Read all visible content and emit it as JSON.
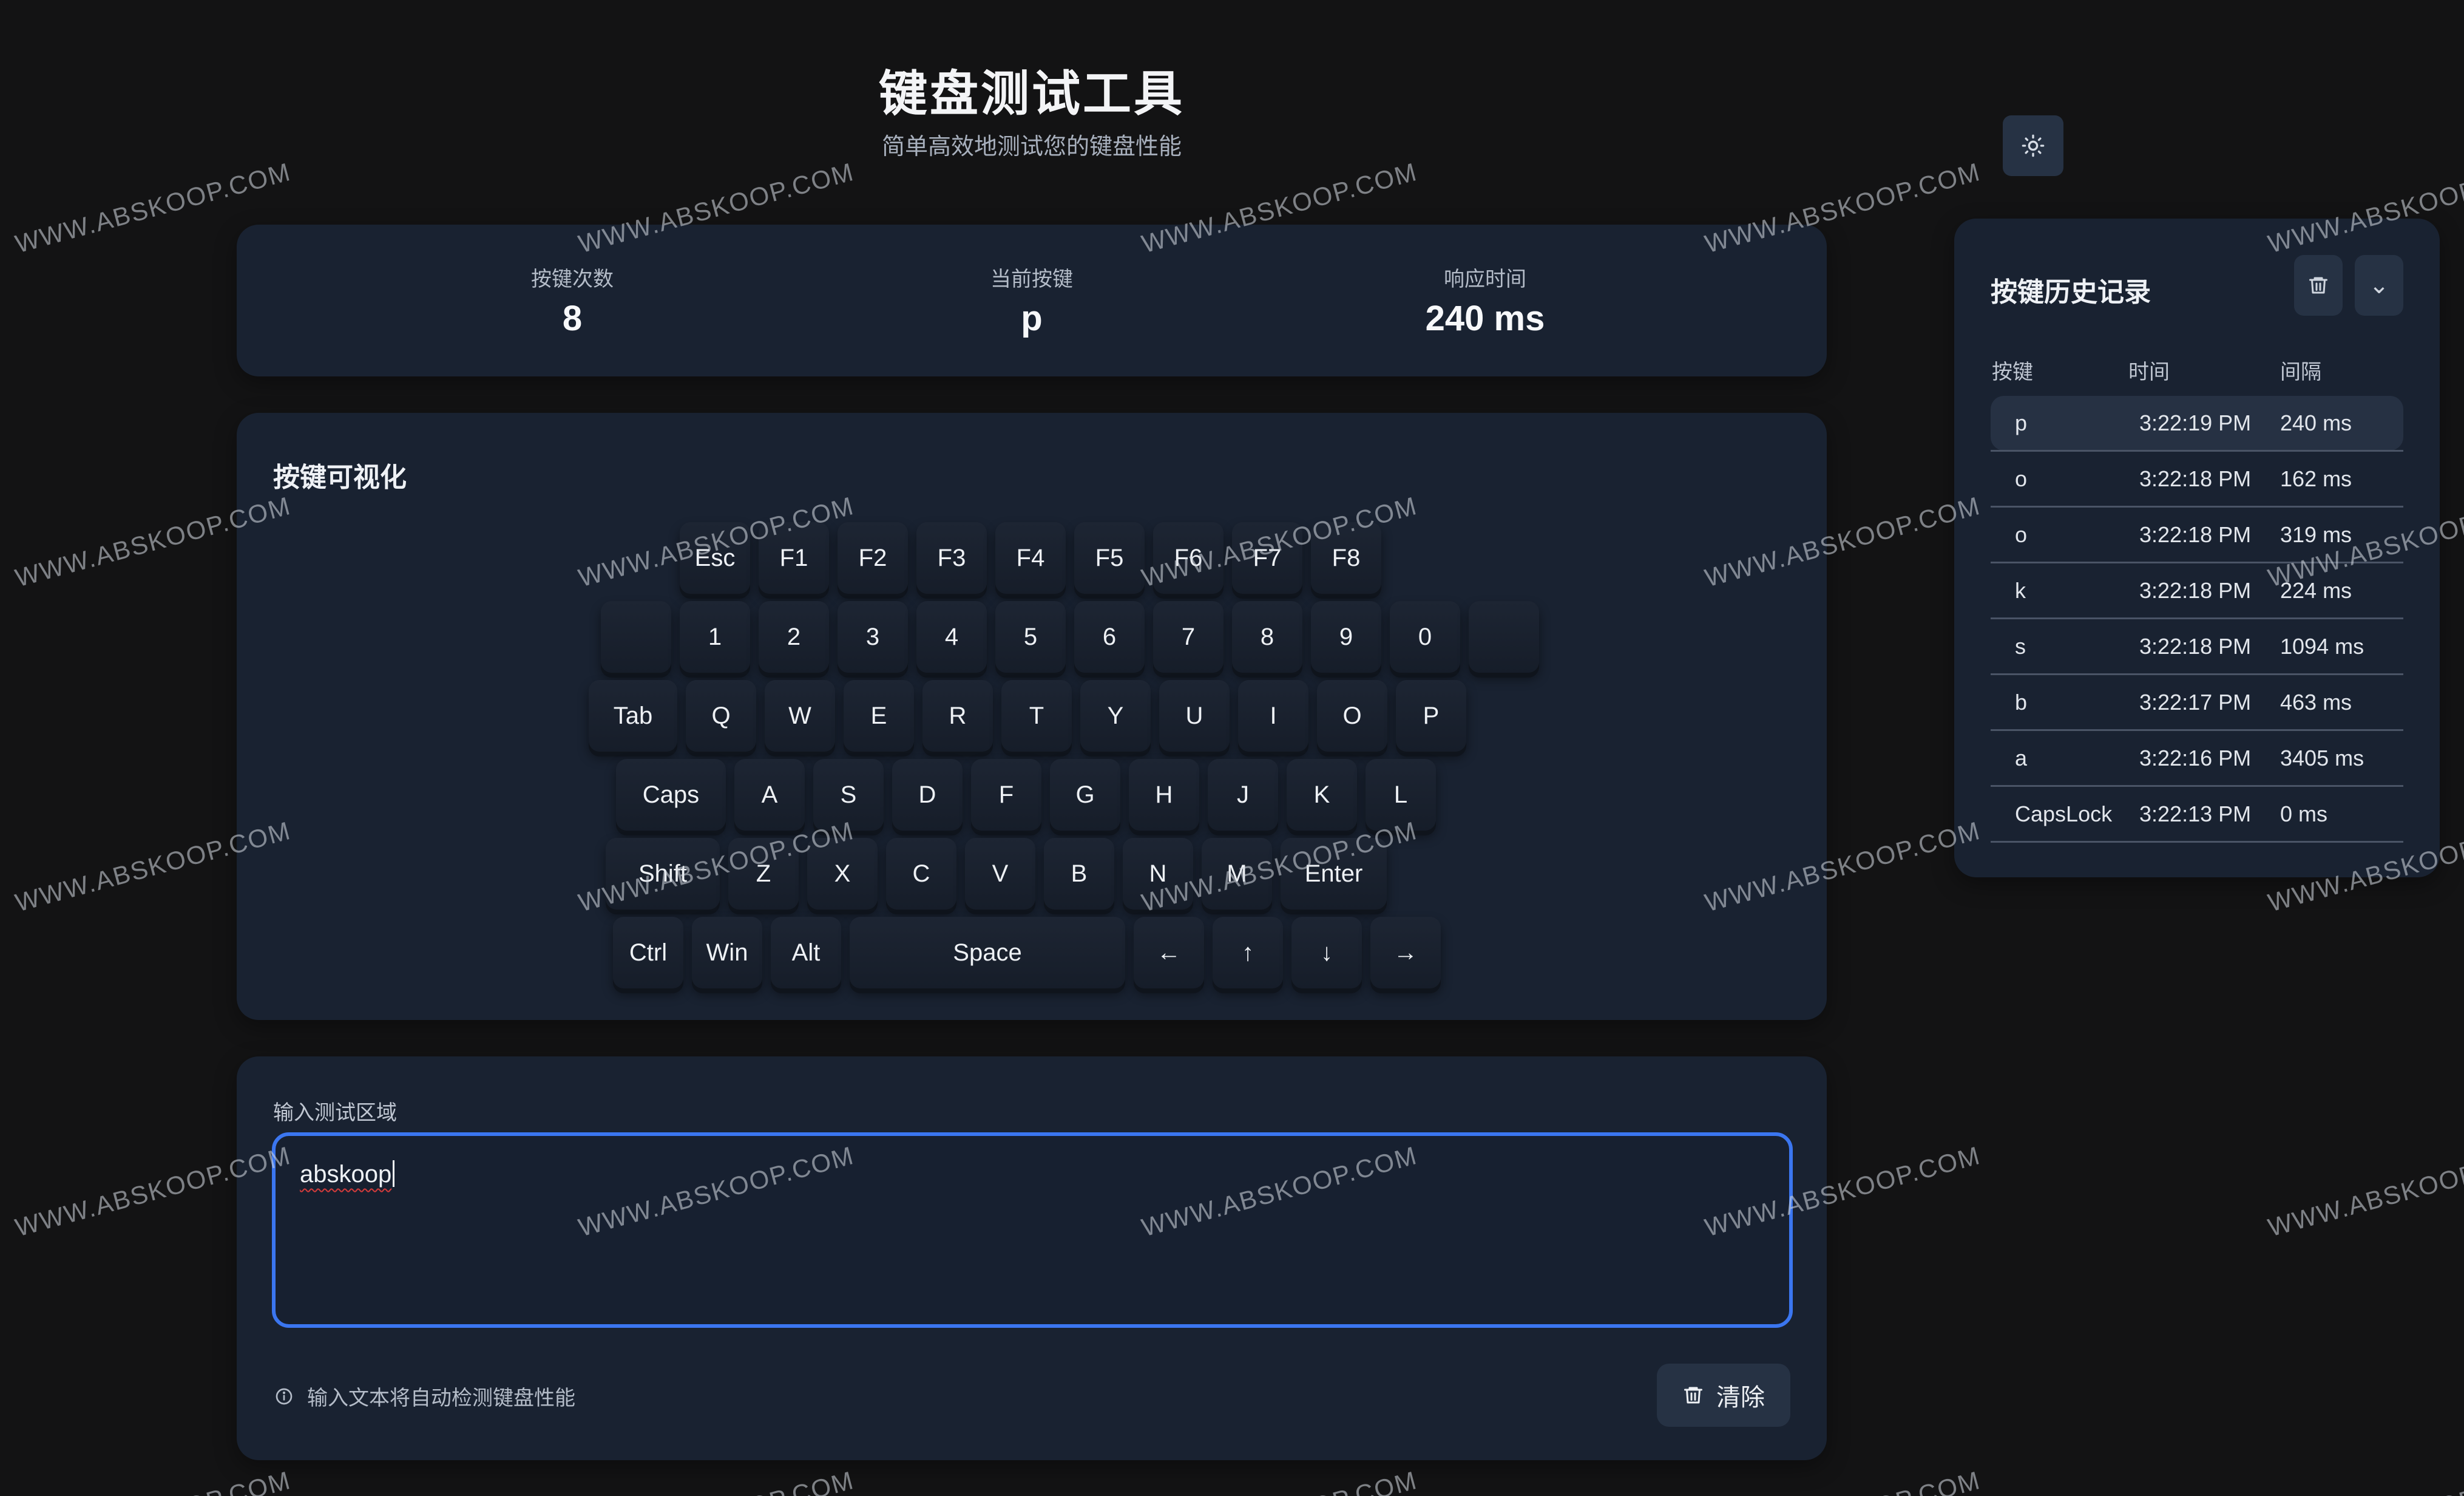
{
  "header": {
    "title": "键盘测试工具",
    "subtitle": "简单高效地测试您的键盘性能"
  },
  "stats": {
    "count_label": "按键次数",
    "count_value": "8",
    "current_label": "当前按键",
    "current_value": "p",
    "response_label": "响应时间",
    "response_value": "240 ms"
  },
  "keyboard": {
    "title": "按键可视化",
    "rows": [
      [
        "Esc",
        "F1",
        "F2",
        "F3",
        "F4",
        "F5",
        "F6",
        "F7",
        "F8"
      ],
      [
        "",
        "1",
        "2",
        "3",
        "4",
        "5",
        "6",
        "7",
        "8",
        "9",
        "0",
        ""
      ],
      [
        "Tab",
        "Q",
        "W",
        "E",
        "R",
        "T",
        "Y",
        "U",
        "I",
        "O",
        "P"
      ],
      [
        "Caps",
        "A",
        "S",
        "D",
        "F",
        "G",
        "H",
        "J",
        "K",
        "L"
      ],
      [
        "Shift",
        "Z",
        "X",
        "C",
        "V",
        "B",
        "N",
        "M",
        "Enter"
      ],
      [
        "Ctrl",
        "Win",
        "Alt",
        "Space",
        "←",
        "↑",
        "↓",
        "→"
      ]
    ]
  },
  "input": {
    "label": "输入测试区域",
    "value": "abskoop",
    "hint": "输入文本将自动检测键盘性能",
    "clear_label": "清除"
  },
  "history": {
    "title": "按键历史记录",
    "export_symbol": "⌄",
    "col_key": "按键",
    "col_time": "时间",
    "col_interval": "间隔",
    "rows": [
      {
        "key": "p",
        "time": "3:22:19 PM",
        "interval": "240 ms"
      },
      {
        "key": "o",
        "time": "3:22:18 PM",
        "interval": "162 ms"
      },
      {
        "key": "o",
        "time": "3:22:18 PM",
        "interval": "319 ms"
      },
      {
        "key": "k",
        "time": "3:22:18 PM",
        "interval": "224 ms"
      },
      {
        "key": "s",
        "time": "3:22:18 PM",
        "interval": "1094 ms"
      },
      {
        "key": "b",
        "time": "3:22:17 PM",
        "interval": "463 ms"
      },
      {
        "key": "a",
        "time": "3:22:16 PM",
        "interval": "3405 ms"
      },
      {
        "key": "CapsLock",
        "time": "3:22:13 PM",
        "interval": "0 ms"
      }
    ]
  },
  "watermark": "WWW.ABSKOOP.COM",
  "colors": {
    "background": "#131314",
    "panel": "#192231",
    "accent": "#3b76f0",
    "active_row": "#263143"
  }
}
